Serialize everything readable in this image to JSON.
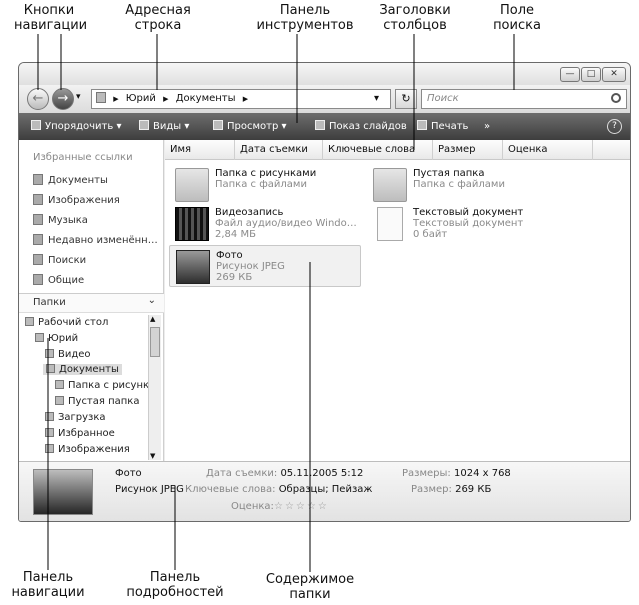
{
  "callouts": {
    "nav_buttons": [
      "Кнопки",
      "навигации"
    ],
    "address_bar": [
      "Адресная",
      "строка"
    ],
    "toolbar": [
      "Панель",
      "инструментов"
    ],
    "column_headers": [
      "Заголовки",
      "столбцов"
    ],
    "search_field": [
      "Поле",
      "поиска"
    ],
    "nav_pane": [
      "Панель",
      "навигации"
    ],
    "details_pane": [
      "Панель",
      "подробностей"
    ],
    "folder_contents": [
      "Содержимое",
      "папки"
    ]
  },
  "window": {
    "buttons": [
      "—",
      "□",
      "✕"
    ],
    "address": {
      "crumbs": [
        "Юрий",
        "Документы"
      ],
      "dropdown": "▾",
      "refresh": "↻"
    },
    "search": {
      "placeholder": "Поиск",
      "icon": "search-icon"
    },
    "toolbar": {
      "organize": "Упорядочить",
      "views": "Виды",
      "preview": "Просмотр",
      "slideshow": "Показ слайдов",
      "print": "Печать",
      "more": "»",
      "help": "?"
    },
    "favorites": {
      "title": "Избранные ссылки",
      "items": [
        "Документы",
        "Изображения",
        "Музыка",
        "Недавно изменённ…",
        "Поиски",
        "Общие"
      ]
    },
    "folders": {
      "title": "Папки",
      "chevron": "⌄",
      "tree": [
        "Рабочий стол",
        "Юрий",
        "Видео",
        "Документы",
        "Папка с рисунк",
        "Пустая папка",
        "Загрузка",
        "Избранное",
        "Изображения"
      ]
    },
    "columns": [
      "Имя",
      "Дата съемки",
      "Ключевые слова",
      "Размер",
      "Оценка"
    ],
    "items": [
      {
        "name": "Папка с рисунками",
        "line2": "Папка с файлами",
        "line3": "",
        "icon": "folder-icon"
      },
      {
        "name": "Пустая папка",
        "line2": "Папка с файлами",
        "line3": "",
        "icon": "folder-icon"
      },
      {
        "name": "Видеозапись",
        "line2": "Файл аудио/видео Windo…",
        "line3": "2,84 МБ",
        "icon": "film-icon"
      },
      {
        "name": "Текстовый документ",
        "line2": "Текстовый документ",
        "line3": "0 байт",
        "icon": "document-icon"
      },
      {
        "name": "Фото",
        "line2": "Рисунок JPEG",
        "line3": "269 КБ",
        "icon": "photo-icon"
      }
    ],
    "details": {
      "name": "Фото",
      "type": "Рисунок JPEG",
      "date_label": "Дата съемки:",
      "date_value": "05.11.2005 5:12",
      "keywords_label": "Ключевые слова:",
      "keywords_value": "Образцы; Пейзаж",
      "rating_label": "Оценка:",
      "stars": "☆☆☆☆☆",
      "dimensions_label": "Размеры:",
      "dimensions_value": "1024 x 768",
      "size_label": "Размер:",
      "size_value": "269 КБ"
    }
  }
}
